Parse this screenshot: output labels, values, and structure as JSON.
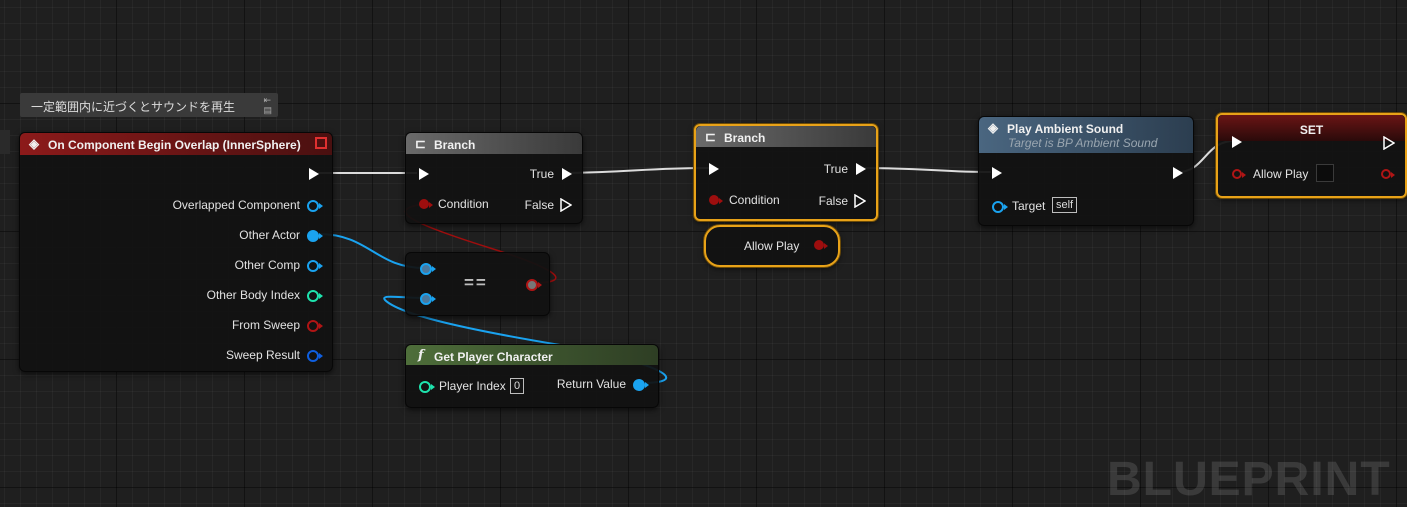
{
  "comment": {
    "text": "一定範囲内に近づくとサウンドを再生"
  },
  "event_node": {
    "title": "On Component Begin Overlap (InnerSphere)",
    "pins": [
      "Overlapped Component",
      "Other Actor",
      "Other Comp",
      "Other Body Index",
      "From Sweep",
      "Sweep Result"
    ]
  },
  "branch1": {
    "title": "Branch",
    "condition": "Condition",
    "true_label": "True",
    "false_label": "False"
  },
  "equal_node": {
    "op": "=="
  },
  "get_player": {
    "title": "Get Player Character",
    "input_label": "Player Index",
    "input_value": "0",
    "output_label": "Return Value"
  },
  "branch2": {
    "title": "Branch",
    "condition": "Condition",
    "true_label": "True",
    "false_label": "False"
  },
  "allow_play_getter": {
    "label": "Allow Play"
  },
  "play_sound": {
    "title": "Play Ambient Sound",
    "subtitle": "Target is BP Ambient Sound",
    "target_label": "Target",
    "target_value": "self"
  },
  "set_node": {
    "title": "SET",
    "var_label": "Allow Play"
  },
  "watermark": "BLUEPRINT",
  "colors": {
    "bool": "#9e0e0e",
    "object": "#1aa3f0",
    "int": "#1ee3ad",
    "struct": "#0f5fe0",
    "event_header": "#8c1a1a",
    "func_header": "#4e6e3a",
    "target_header": "#3e5a72",
    "select": "#e8a218"
  }
}
